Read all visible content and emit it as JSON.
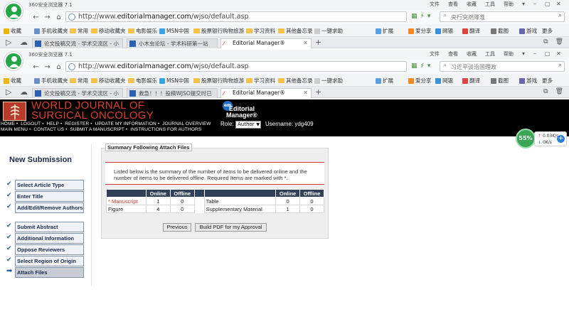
{
  "browser": {
    "title": "360安全浏览器 7.1",
    "menu": [
      "文件",
      "查看",
      "收藏",
      "工具",
      "帮助"
    ],
    "url_prefix": "http://www.",
    "url_domain": "editorialmanager.com",
    "url_path": "/wjso/default.asp",
    "search_placeholder_1": "央行突然降准",
    "search_placeholder_2": "习近平谈治国理政",
    "bookmarks": [
      "收藏",
      "手机收藏夹",
      "常用",
      "移动收藏夹",
      "电影娱乐",
      "MSN中国",
      "股票银行购物旅游",
      "学习资料",
      "其他备忘录",
      "一键求助"
    ],
    "tools": [
      "扩展",
      "爱分享",
      "网银",
      "翻译",
      "截图",
      "游戏",
      "更多"
    ],
    "tabs_1": [
      {
        "label": "论文投稿交流 - 学术交流区 - 小"
      },
      {
        "label": "小木虫论坛 - 学术科研第一站"
      },
      {
        "label": "Editorial Manager®"
      }
    ],
    "tabs_2": [
      {
        "label": "论文投稿交流 - 学术交流区 - 小"
      },
      {
        "label": "救急！！！投稿WJSO提交时已"
      },
      {
        "label": "Editorial Manager®"
      }
    ]
  },
  "journal": {
    "title_line1": "WORLD JOURNAL OF",
    "title_line2": "SURGICAL ONCOLOGY",
    "em_logo_line1": "Editorial",
    "em_logo_line2": "Manager®",
    "em_disc": "em",
    "nav_row1": [
      "HOME",
      "LOGOUT",
      "HELP",
      "REGISTER",
      "UPDATE MY INFORMATION",
      "JOURNAL OVERVIEW"
    ],
    "nav_row2": [
      "MAIN MENU",
      "CONTACT US",
      "SUBMIT A MANUSCRIPT",
      "INSTRUCTIONS FOR AUTHORS"
    ],
    "role_label": "Role:",
    "role_value": "Author",
    "username": "Username: ydg409"
  },
  "speed_widget": {
    "percent": "55%",
    "up": "0.03K/s",
    "down": "0K/s"
  },
  "sidebar": {
    "heading": "New Submission",
    "steps": [
      {
        "label": "Select Article Type",
        "state": "done"
      },
      {
        "label": "Enter Title",
        "state": "done"
      },
      {
        "label": "Add/Edit/Remove Authors",
        "state": "done"
      },
      {
        "label": "Submit Abstract",
        "state": "done"
      },
      {
        "label": "Additional Information",
        "state": "done"
      },
      {
        "label": "Oppose Reviewers",
        "state": "done"
      },
      {
        "label": "Select Region of Origin",
        "state": "done"
      },
      {
        "label": "Attach Files",
        "state": "current"
      }
    ]
  },
  "summary": {
    "legend": "Summary Following Attach Files",
    "info": "Listed below is the summary of the number of items to be delivered online and the number of items to be delivered offline. Required Items are marked with *.",
    "columns": [
      "",
      "Online",
      "Offline"
    ],
    "left_rows": [
      {
        "name": "* Manuscript",
        "online": "1",
        "offline": "0",
        "required": true
      },
      {
        "name": "Figure",
        "online": "4",
        "offline": "0",
        "required": false
      }
    ],
    "right_rows": [
      {
        "name": "Table",
        "online": "0",
        "offline": "0"
      },
      {
        "name": "Supplementary Material",
        "online": "1",
        "offline": "0"
      }
    ],
    "previous_button": "Previous",
    "build_pdf_button": "Build PDF for my Approval"
  }
}
